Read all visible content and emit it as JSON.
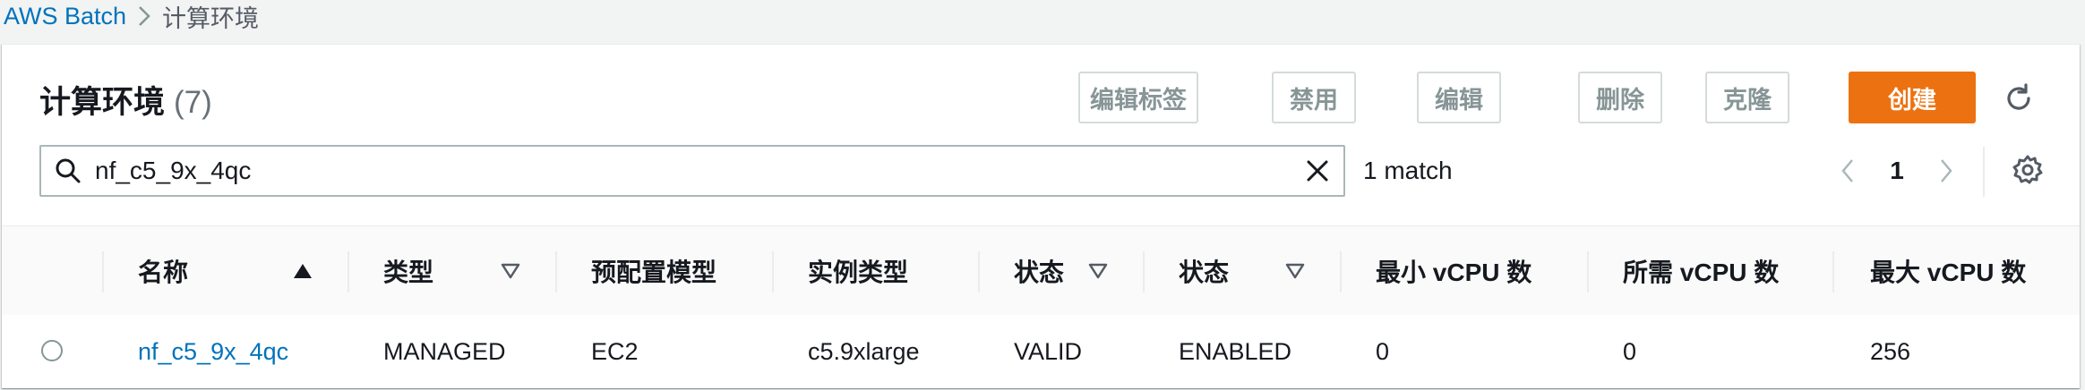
{
  "breadcrumb": {
    "root": "AWS Batch",
    "current": "计算环境"
  },
  "header": {
    "title": "计算环境",
    "count": "(7)"
  },
  "actions": {
    "edit_tags": "编辑标签",
    "disable": "禁用",
    "edit": "编辑",
    "delete": "删除",
    "clone": "克隆",
    "create": "创建"
  },
  "search": {
    "value": "nf_c5_9x_4qc",
    "match_text": "1 match"
  },
  "pagination": {
    "current_page": "1"
  },
  "table": {
    "columns": [
      "名称",
      "类型",
      "预配置模型",
      "实例类型",
      "状态",
      "状态",
      "最小 vCPU 数",
      "所需 vCPU 数",
      "最大 vCPU 数"
    ],
    "sort": {
      "active_column": "名称",
      "direction": "ascending"
    },
    "rows": [
      {
        "name": "nf_c5_9x_4qc",
        "type": "MANAGED",
        "provisioning": "EC2",
        "instance_type": "c5.9xlarge",
        "state": "VALID",
        "status": "ENABLED",
        "min_vcpu": "0",
        "desired_vcpu": "0",
        "max_vcpu": "256"
      }
    ]
  },
  "colors": {
    "link": "#0073bb",
    "primary": "#ec7211",
    "disabled_text": "#879596",
    "border": "#d5dbdb"
  },
  "icons": [
    "chevron-right-icon",
    "refresh-icon",
    "search-icon",
    "clear-icon",
    "chevron-left-icon",
    "settings-gear-icon",
    "sort-ascending-icon",
    "sort-descending-icon"
  ]
}
